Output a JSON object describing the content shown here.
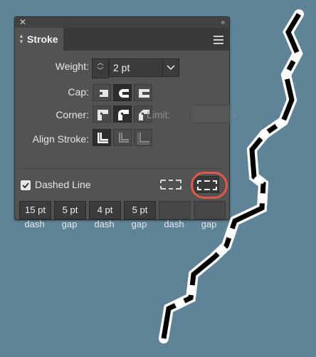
{
  "panel": {
    "title_bar": {
      "close_icon": "close-icon",
      "collapse_icon": "double-chevron-icon"
    },
    "tab": {
      "label": "Stroke"
    },
    "weight": {
      "label": "Weight:",
      "value": "2 pt"
    },
    "cap": {
      "label": "Cap:",
      "options": [
        "butt-cap",
        "round-cap",
        "projecting-cap"
      ],
      "selected": "round-cap"
    },
    "corner": {
      "label": "Corner:",
      "options": [
        "miter-join",
        "round-join",
        "bevel-join"
      ],
      "selected": "round-join",
      "limit_label": "Limit:",
      "limit_value": "",
      "limit_suffix": "x"
    },
    "align_stroke": {
      "label": "Align Stroke:",
      "options": [
        "align-center",
        "align-inside",
        "align-outside"
      ],
      "selected": "align-center"
    },
    "dashed_line": {
      "label": "Dashed Line",
      "checked": true,
      "alignment_options": [
        "preserve-exact-dash",
        "align-dashes-to-corners"
      ],
      "selected_alignment": "align-dashes-to-corners",
      "fields": [
        {
          "value": "15 pt",
          "caption": "dash"
        },
        {
          "value": "5 pt",
          "caption": "gap"
        },
        {
          "value": "4 pt",
          "caption": "dash"
        },
        {
          "value": "5 pt",
          "caption": "gap"
        },
        {
          "value": "",
          "caption": "dash"
        },
        {
          "value": "",
          "caption": "gap"
        }
      ]
    }
  },
  "colors": {
    "background": "#5f8497",
    "panel": "#535353",
    "highlight": "#e2594a",
    "stroke_path": "#000000",
    "stroke_outline": "#ffffff"
  }
}
